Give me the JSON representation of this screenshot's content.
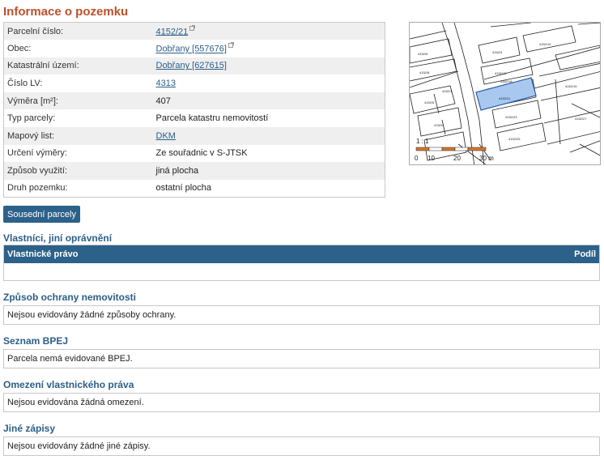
{
  "page_title": "Informace o pozemku",
  "parcel": {
    "rows": [
      {
        "label": "Parcelní číslo:",
        "value": "4152/21",
        "link": true,
        "ext": true
      },
      {
        "label": "Obec:",
        "value": "Dobřany [557676]",
        "link": true,
        "ext": true
      },
      {
        "label": "Katastrální území:",
        "value": "Dobřany [627615]",
        "link": true,
        "ext": false
      },
      {
        "label": "Číslo LV:",
        "value": "4313",
        "link": true,
        "ext": false
      },
      {
        "label": "Výměra [m²]:",
        "value": "407",
        "link": false,
        "ext": false
      },
      {
        "label": "Typ parcely:",
        "value": "Parcela katastru nemovitostí",
        "link": false,
        "ext": false
      },
      {
        "label": "Mapový list:",
        "value": "DKM",
        "link": true,
        "ext": false
      },
      {
        "label": "Určení výměry:",
        "value": "Ze souřadnic v S-JTSK",
        "link": false,
        "ext": false
      },
      {
        "label": "Způsob využití:",
        "value": "jiná plocha",
        "link": false,
        "ext": false
      },
      {
        "label": "Druh pozemku:",
        "value": "ostatní plocha",
        "link": false,
        "ext": false
      }
    ]
  },
  "map": {
    "scale": "1 : 1",
    "scale_ticks": [
      "0",
      "10",
      "20",
      "30 m"
    ],
    "highlight_color": "#a8c8f0",
    "scale_color": "#d4772b"
  },
  "buttons": {
    "neighbors": "Sousední parcely"
  },
  "owners": {
    "title": "Vlastníci, jiní oprávnění",
    "col_right": "Vlastnické právo",
    "col_share": "Podíl"
  },
  "protection": {
    "title": "Způsob ochrany nemovitosti",
    "text": "Nejsou evidovány žádné způsoby ochrany."
  },
  "bpej": {
    "title": "Seznam BPEJ",
    "text": "Parcela nemá evidované BPEJ."
  },
  "restrictions": {
    "title": "Omezení vlastnického práva",
    "text": "Nejsou evidována žádná omezení."
  },
  "other": {
    "title": "Jiné zápisy",
    "text": "Nejsou evidovány žádné jiné zápisy."
  },
  "colors": {
    "title": "#c0502a",
    "accent": "#2c6189",
    "link": "#2b5f8a"
  }
}
